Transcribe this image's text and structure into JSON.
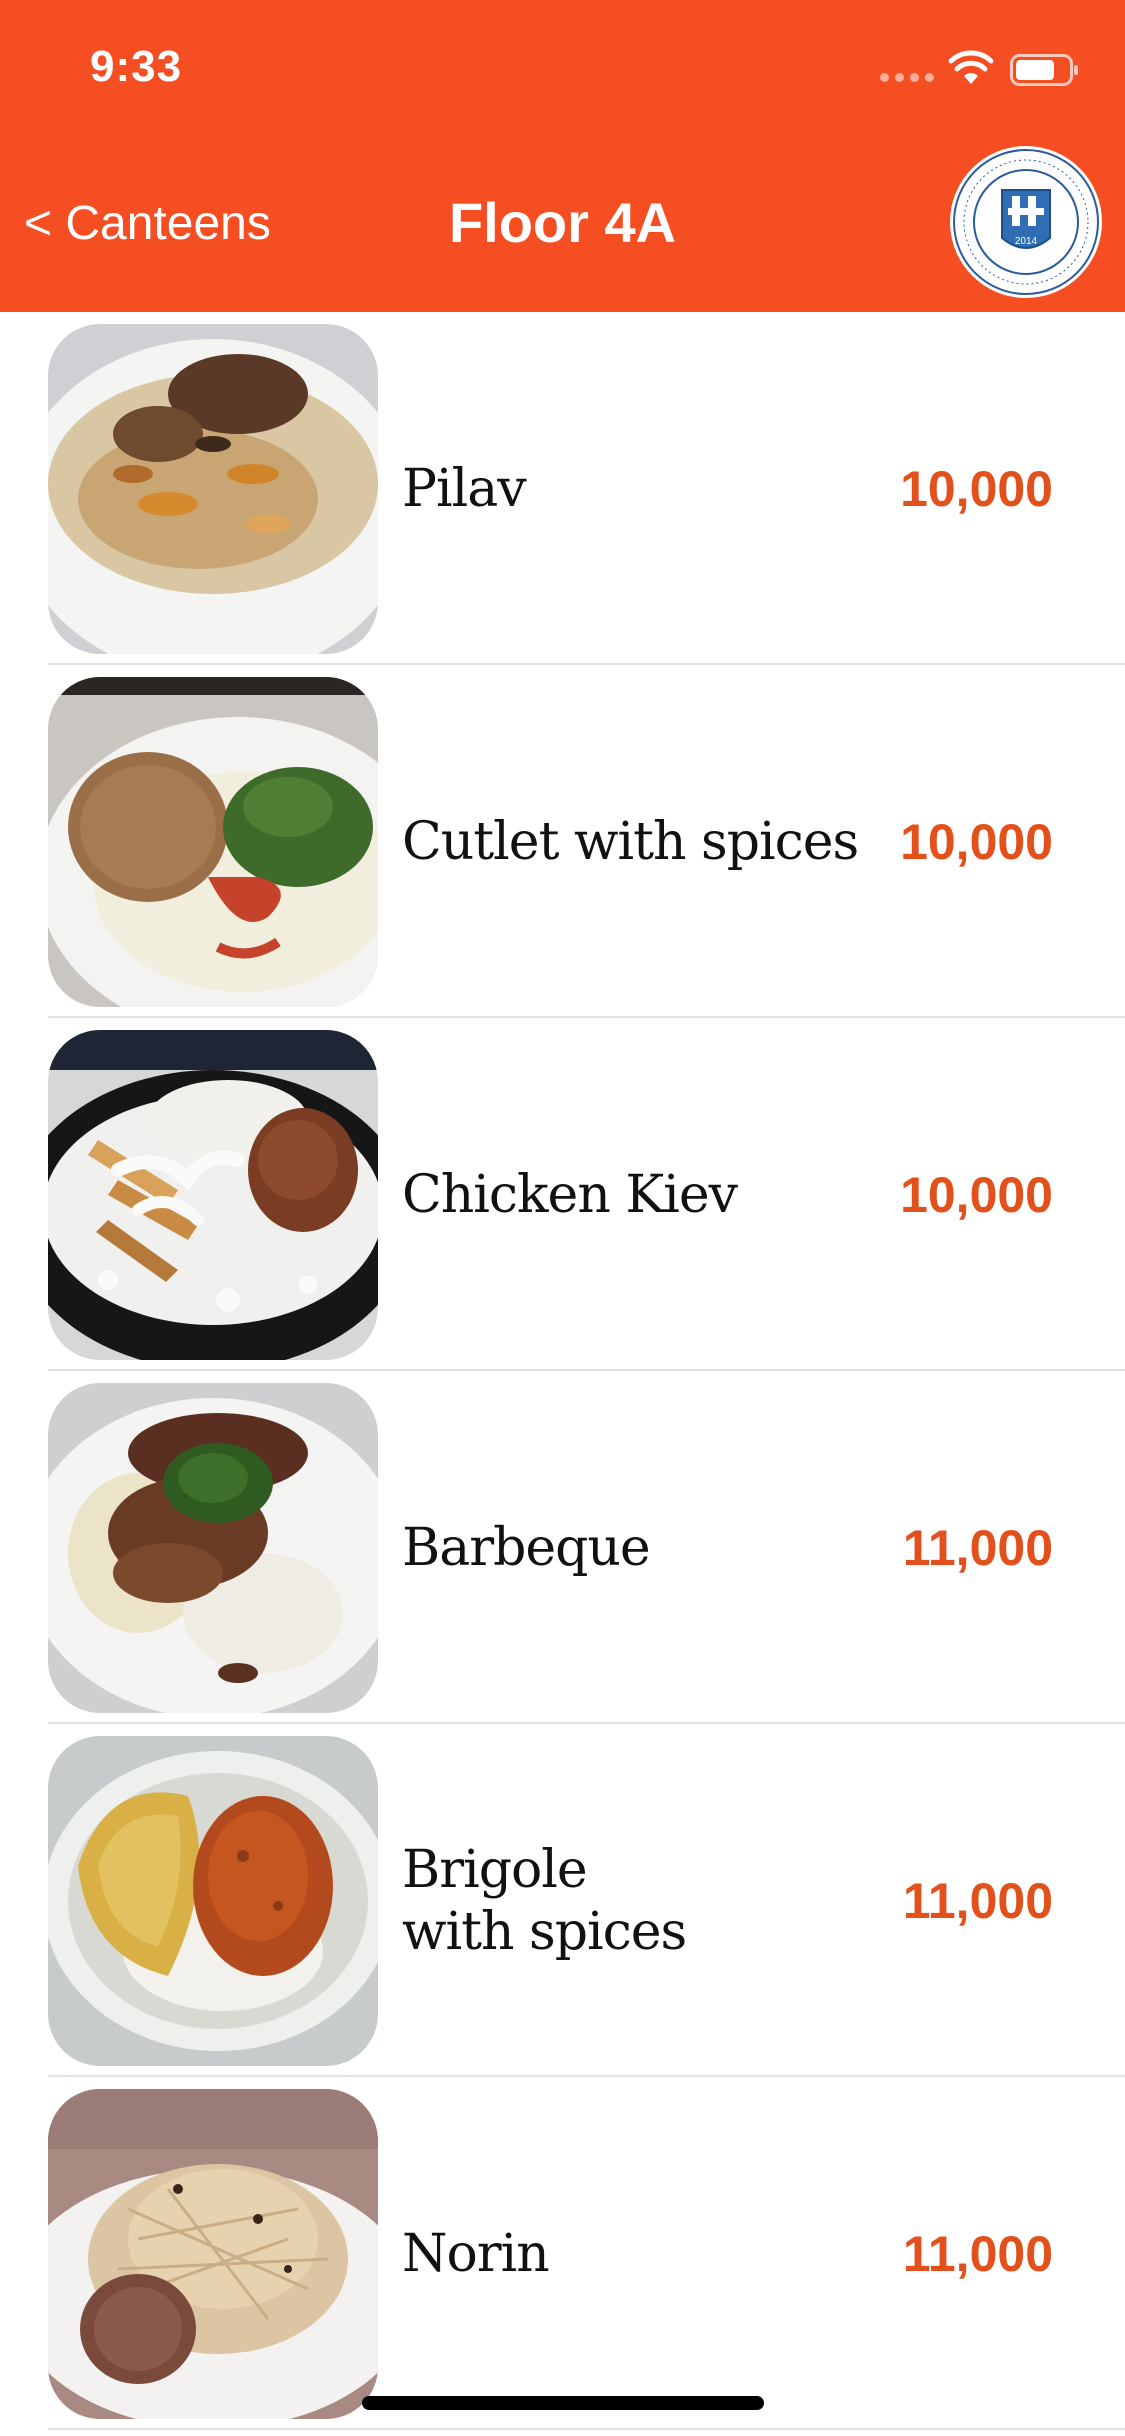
{
  "status_bar": {
    "time": "9:33",
    "wifi_icon": "wifi-icon",
    "battery_icon": "battery-icon"
  },
  "nav": {
    "back_label": "< Canteens",
    "title": "Floor 4A",
    "logo_icon": "university-seal-logo",
    "logo_year": "2014"
  },
  "colors": {
    "accent": "#f44e22",
    "price": "#e2501c"
  },
  "menu": {
    "items": [
      {
        "name": "Pilav",
        "price": "10,000",
        "image": "pilav-photo"
      },
      {
        "name": "Cutlet with spices",
        "price": "10,000",
        "image": "cutlet-photo"
      },
      {
        "name": "Chicken Kiev",
        "price": "10,000",
        "image": "chicken-kiev-photo"
      },
      {
        "name": "Barbeque",
        "price": "11,000",
        "image": "barbeque-photo"
      },
      {
        "name": "Brigole\nwith spices",
        "price": "11,000",
        "image": "brigole-photo"
      },
      {
        "name": "Norin",
        "price": "11,000",
        "image": "norin-photo"
      }
    ]
  }
}
